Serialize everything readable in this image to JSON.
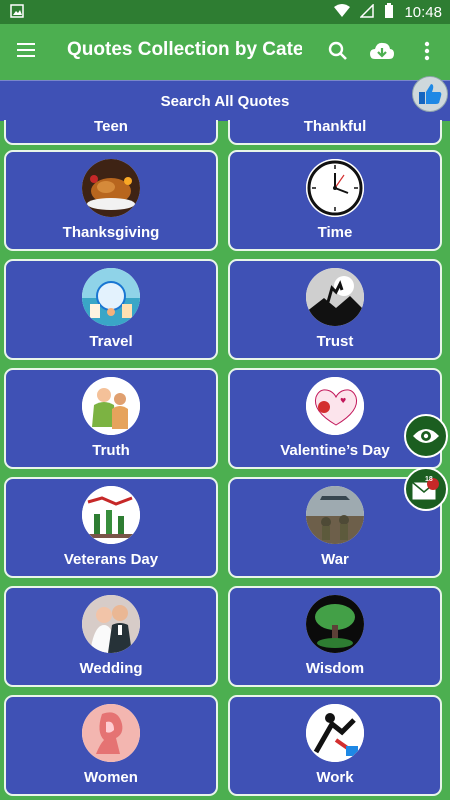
{
  "status": {
    "time": "10:48"
  },
  "appbar": {
    "title": "Quotes Collection by Cate…",
    "menu_icon": "hamburger-menu-icon",
    "search_icon": "search-icon",
    "download_icon": "cloud-download-icon",
    "overflow_icon": "more-vert-icon"
  },
  "search": {
    "label": "Search All Quotes"
  },
  "categories": [
    {
      "label": "Teen"
    },
    {
      "label": "Thankful"
    },
    {
      "label": "Thanksgiving"
    },
    {
      "label": "Time"
    },
    {
      "label": "Travel"
    },
    {
      "label": "Trust"
    },
    {
      "label": "Truth"
    },
    {
      "label": "Valentine’s Day"
    },
    {
      "label": "Veterans Day"
    },
    {
      "label": "War"
    },
    {
      "label": "Wedding"
    },
    {
      "label": "Wisdom"
    },
    {
      "label": "Women"
    },
    {
      "label": "Work"
    }
  ],
  "fabs": {
    "view_icon": "eye-icon",
    "mail_icon": "mail-icon",
    "mail_badge": "18"
  },
  "colors": {
    "primary": "#4caf50",
    "dark": "#2e7d32",
    "tile": "#3f51b5"
  }
}
